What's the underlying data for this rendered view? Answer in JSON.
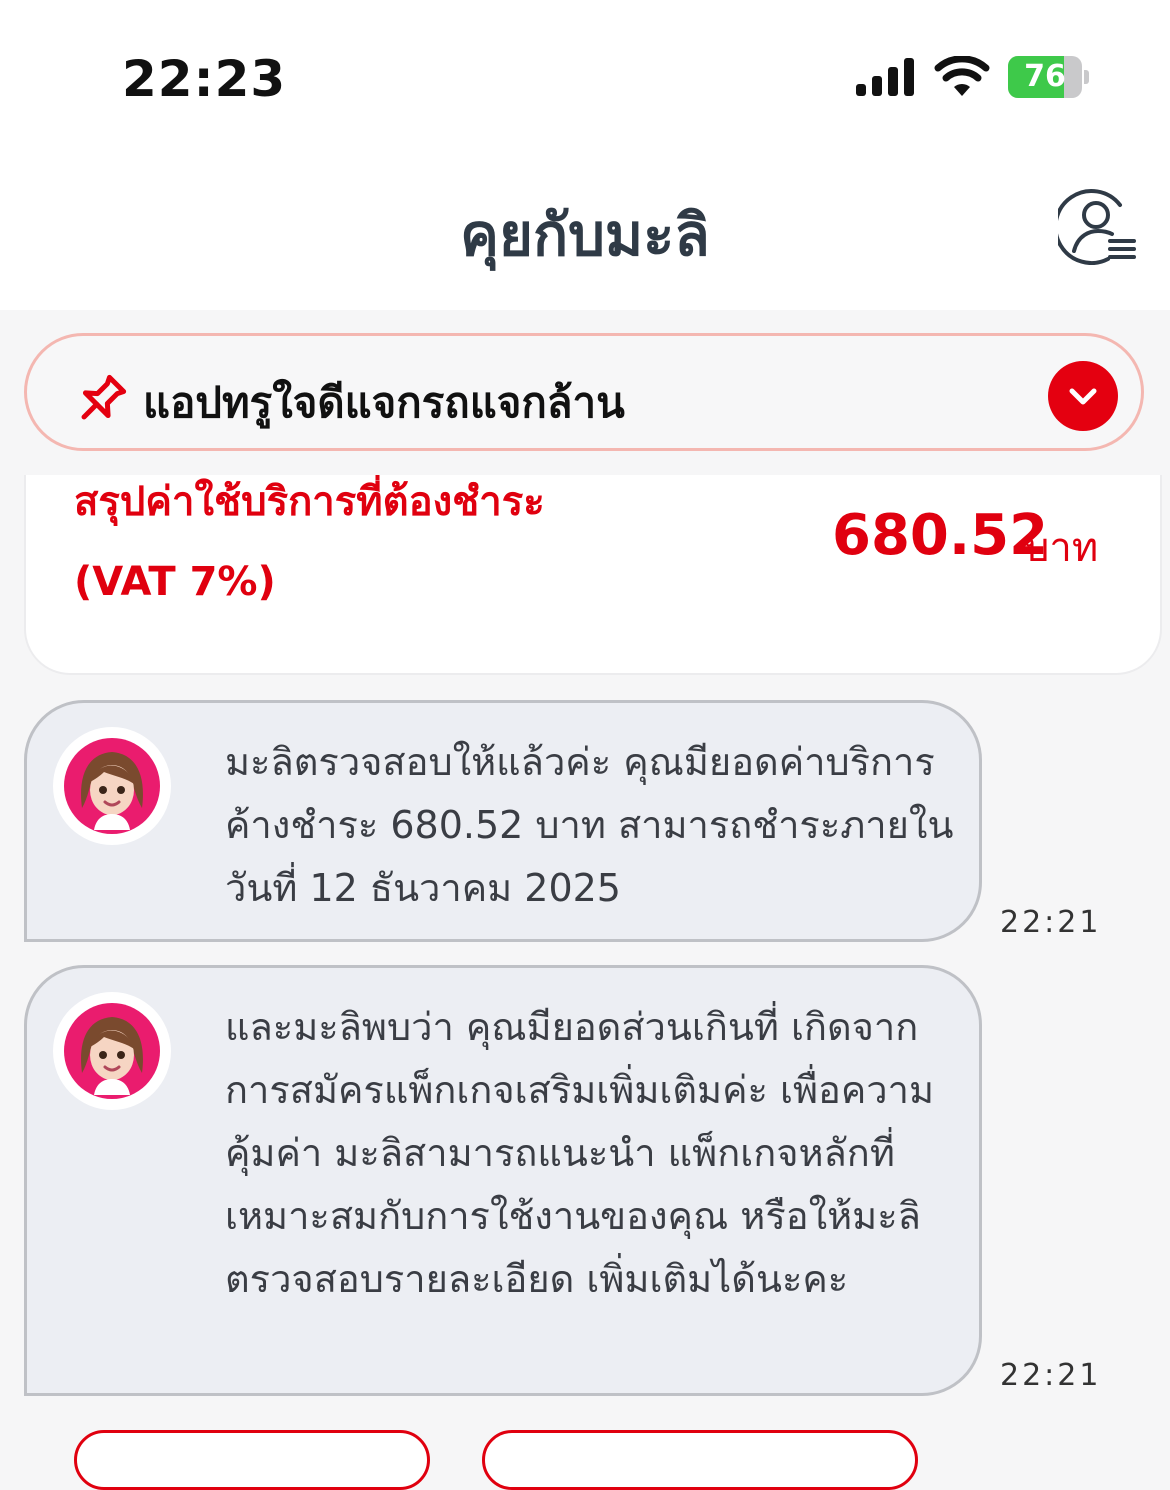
{
  "status_bar": {
    "time": "22:23",
    "battery_level": "76",
    "battery_fraction": 0.76,
    "battery_color": "#3ec94a",
    "icons": [
      "cellular-signal-icon",
      "wifi-icon",
      "battery-charging-icon"
    ]
  },
  "header": {
    "title": "คุยกับมะลิ",
    "right_icon": "profile-menu-icon"
  },
  "pinned_banner": {
    "text": "แอปทรูใจดีแจกรถแจกล้าน",
    "icon": "pin-icon",
    "toggle_icon": "chevron-down-icon",
    "accent_color": "#e40010"
  },
  "summary_card": {
    "label": "สรุปค่าใช้บริการที่ต้องชำระ",
    "vat": "(VAT 7%)",
    "amount": "680.52",
    "unit": "บาท",
    "accent_color": "#e0000f"
  },
  "messages": [
    {
      "avatar": "mali-avatar",
      "text": "มะลิตรวจสอบให้แล้วค่ะ คุณมียอดค่าบริการค้างชำระ 680.52 บาท สามารถชำระภายในวันที่ 12 ธันวาคม 2025",
      "time": "22:21"
    },
    {
      "avatar": "mali-avatar",
      "text": "และมะลิพบว่า คุณมียอดส่วนเกินที่ เกิดจากการสมัครแพ็กเกจเสริมเพิ่มเติมค่ะ เพื่อความคุ้มค่า มะลิสามารถแนะนำ แพ็กเกจหลักที่เหมาะสมกับการใช้งานของคุณ หรือให้มะลิตรวจสอบรายละเอียด เพิ่มเติมได้นะคะ",
      "time": "22:21"
    }
  ]
}
